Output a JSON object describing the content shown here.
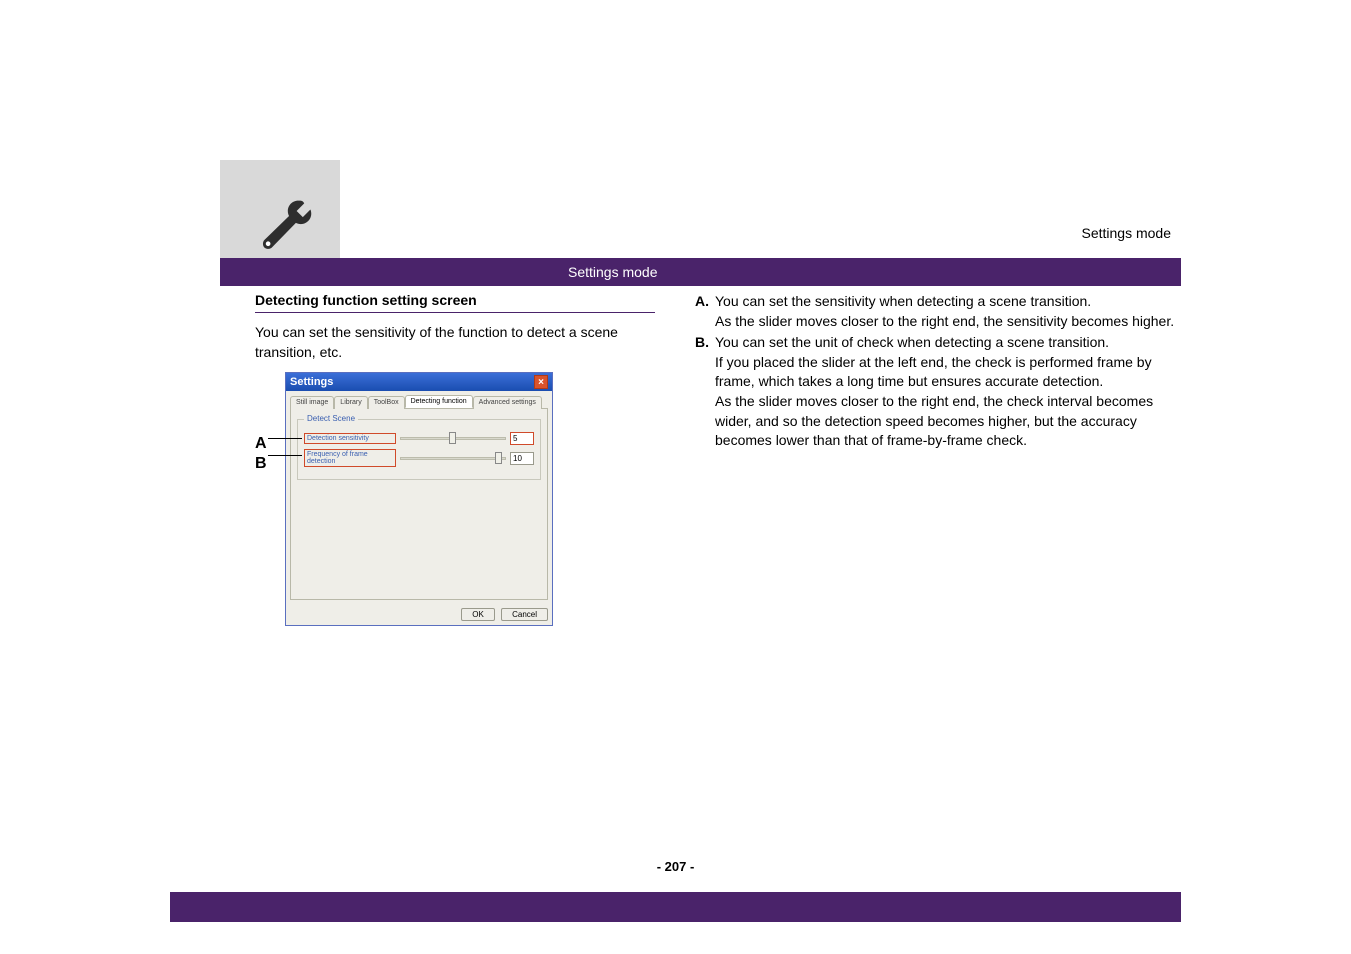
{
  "header": {
    "breadcrumb": "Settings mode",
    "mode_title": "Settings mode"
  },
  "left": {
    "heading": "Detecting function setting screen",
    "intro": "You can set the sensitivity of the function to detect a scene transition, etc.",
    "callout_a": "A",
    "callout_b": "B"
  },
  "dialog": {
    "title": "Settings",
    "tabs": {
      "t1": "Still image",
      "t2": "Library",
      "t3": "ToolBox",
      "t4": "Detecting function",
      "t5": "Advanced settings"
    },
    "fieldset_legend": "Detect Scene",
    "slider_a_label": "Detection sensitivity",
    "slider_a_value": "5",
    "slider_b_label": "Frequency of frame detection",
    "slider_b_value": "10",
    "ok": "OK",
    "cancel": "Cancel"
  },
  "right": {
    "a_key": "A.",
    "a_text1": "You can set the sensitivity when detecting a scene transition.",
    "a_text2": "As the slider moves closer to the right end, the sensitivity becomes higher.",
    "b_key": "B.",
    "b_text1": "You can set the unit of check when detecting a scene transition.",
    "b_text2": "If you placed the slider at the left end, the check is performed frame by frame, which takes a long time but ensures accurate detection.",
    "b_text3": "As the slider moves closer to the right end, the check interval becomes wider, and so the detection speed becomes higher, but the accuracy becomes lower than that of frame-by-frame check."
  },
  "page_number": "- 207 -"
}
